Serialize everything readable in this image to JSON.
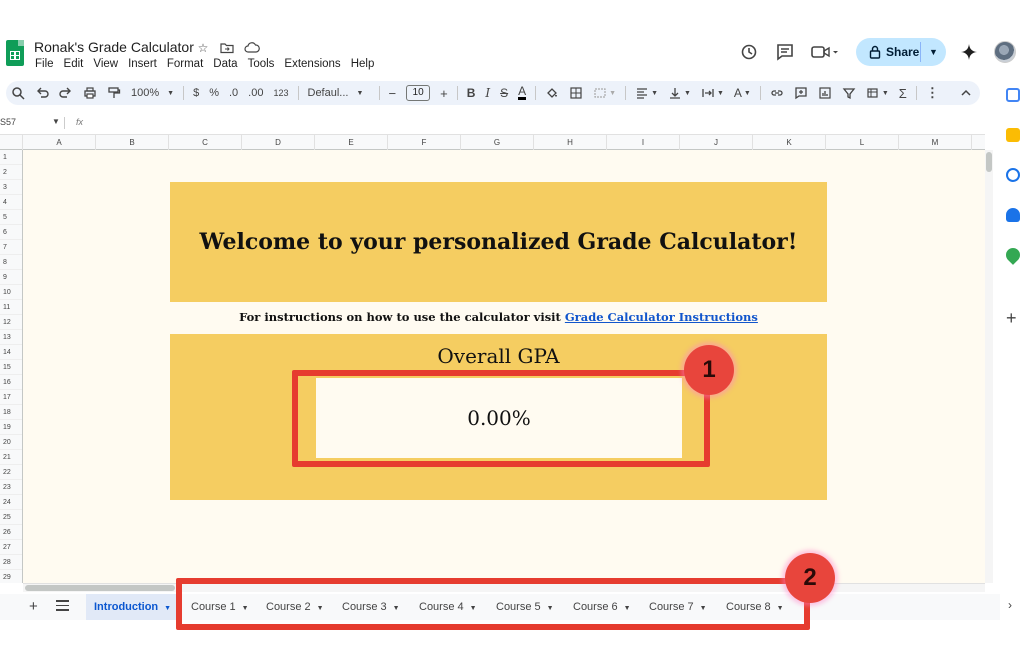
{
  "app": {
    "doc_title": "Ronak's Grade Calculator",
    "menu": [
      "File",
      "Edit",
      "View",
      "Insert",
      "Format",
      "Data",
      "Tools",
      "Extensions",
      "Help"
    ],
    "share_label": "Share"
  },
  "toolbar": {
    "zoom": "100%",
    "currency": "$",
    "percent": "%",
    "dec_decrease": ".0",
    "dec_increase": ".00",
    "number_format": "123",
    "font": "Defaul...",
    "font_size": "10"
  },
  "formula_bar": {
    "name_box": "S57",
    "fx": "fx"
  },
  "grid": {
    "columns": [
      "A",
      "B",
      "C",
      "D",
      "E",
      "F",
      "G",
      "H",
      "I",
      "J",
      "K",
      "L",
      "M"
    ],
    "rows": [
      "1",
      "2",
      "3",
      "4",
      "5",
      "6",
      "7",
      "8",
      "9",
      "10",
      "11",
      "12",
      "13",
      "14",
      "15",
      "16",
      "17",
      "18",
      "19",
      "20",
      "21",
      "22",
      "23",
      "24",
      "25",
      "26",
      "27",
      "28",
      "29"
    ]
  },
  "sheet": {
    "banner": "Welcome to your personalized Grade Calculator!",
    "instructions_prefix": "For instructions on how to use the calculator visit ",
    "instructions_link": "Grade Calculator Instructions",
    "gpa_title": "Overall GPA",
    "gpa_value": "0.00%"
  },
  "tabs": [
    "Introduction",
    "Course 1",
    "Course 2",
    "Course 3",
    "Course 4",
    "Course 5",
    "Course 6",
    "Course 7",
    "Course 8"
  ],
  "annotations": [
    "1",
    "2"
  ],
  "colors": {
    "banner": "#f5cd61",
    "sheet_bg": "#fffbf1",
    "link": "#1155cc",
    "annotation": "#e63c2f",
    "share_bg": "#c2e7ff"
  }
}
